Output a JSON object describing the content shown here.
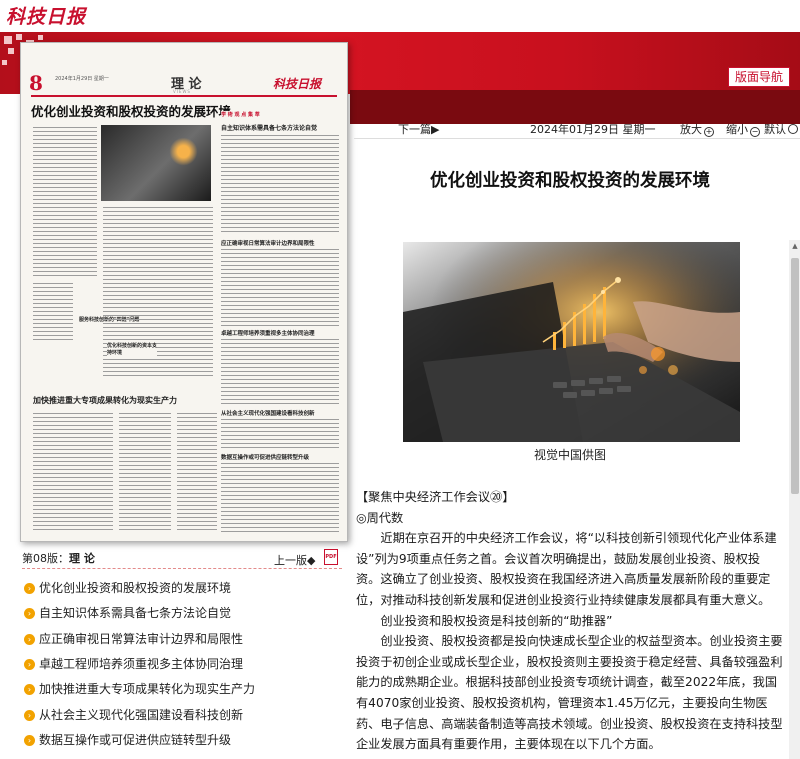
{
  "site": {
    "logo_text": "科技日报"
  },
  "banner": {
    "nav_button": "版面导航"
  },
  "newspaper_page": {
    "page_number": "8",
    "date_line": "2024年1月29日 星期一",
    "section": "理 论",
    "section_sub": "VIEWS",
    "brand": "科技日报",
    "lead_title": "优化创业投资和股权投资的发展环境",
    "right_column_title": "自主知识体系需具备七条方法论自觉",
    "inner_heads": [
      "应正确审视日常算法审计边界和局限性",
      "卓越工程师培养须重视多主体协同治理",
      "从社会主义现代化强国建设看科技创新",
      "数据互操作或可促进供应链转型升级",
      "加快推进重大专项成果转化为现实生产力",
      "政企投资和股权投资是科技创新的\"助推器\"",
      "服务科技创新的\"四链\"问题",
      "优化科技创新的资本支持环境"
    ],
    "column_tag": "学 術 观 点 集 萃"
  },
  "left_panel": {
    "section_label_prefix": "第08版：",
    "section_label_name": "理 论",
    "prev_page": "上一版◆",
    "pdf_icon_text": "PDF",
    "headlines": [
      "优化创业投资和股权投资的发展环境",
      "自主知识体系需具备七条方法论自觉",
      "应正确审视日常算法审计边界和局限性",
      "卓越工程师培养须重视多主体协同治理",
      "加快推进重大专项成果转化为现实生产力",
      "从社会主义现代化强国建设看科技创新",
      "数据互操作或可促进供应链转型升级"
    ]
  },
  "toolbar": {
    "next_page": "下一篇▶",
    "date": "2024年01月29日  星期一",
    "zoom_in": "放大",
    "zoom_out": "缩小",
    "reset": "默认"
  },
  "article": {
    "title": "优化创业投资和股权投资的发展环境",
    "photo_caption": "视觉中国供图",
    "column": "【聚焦中央经济工作会议⑳】",
    "author": "◎周代数",
    "paragraphs": [
      "近期在京召开的中央经济工作会议，将“以科技创新引领现代化产业体系建设”列为9项重点任务之首。会议首次明确提出，鼓励发展创业投资、股权投资。这确立了创业投资、股权投资在我国经济进入高质量发展新阶段的重要定位，对推动科技创新发展和促进创业投资行业持续健康发展都具有重大意义。",
      "创业投资和股权投资是科技创新的“助推器”",
      "创业投资、股权投资都是投向快速成长型企业的权益型资本。创业投资主要投资于初创企业或成长型企业，股权投资则主要投资于稳定经营、具备较强盈利能力的成熟期企业。根据科技部创业投资专项统计调查，截至2022年底，我国有4070家创业投资、股权投资机构，管理资本1.45万亿元，主要投向生物医药、电子信息、高端装备制造等高技术领域。创业投资、股权投资在支持科技型企业发展方面具有重要作用，主要体现在以下几个方面。"
    ]
  },
  "colors": {
    "brand_red": "#c8102e",
    "bullet_orange": "#f2a200"
  }
}
